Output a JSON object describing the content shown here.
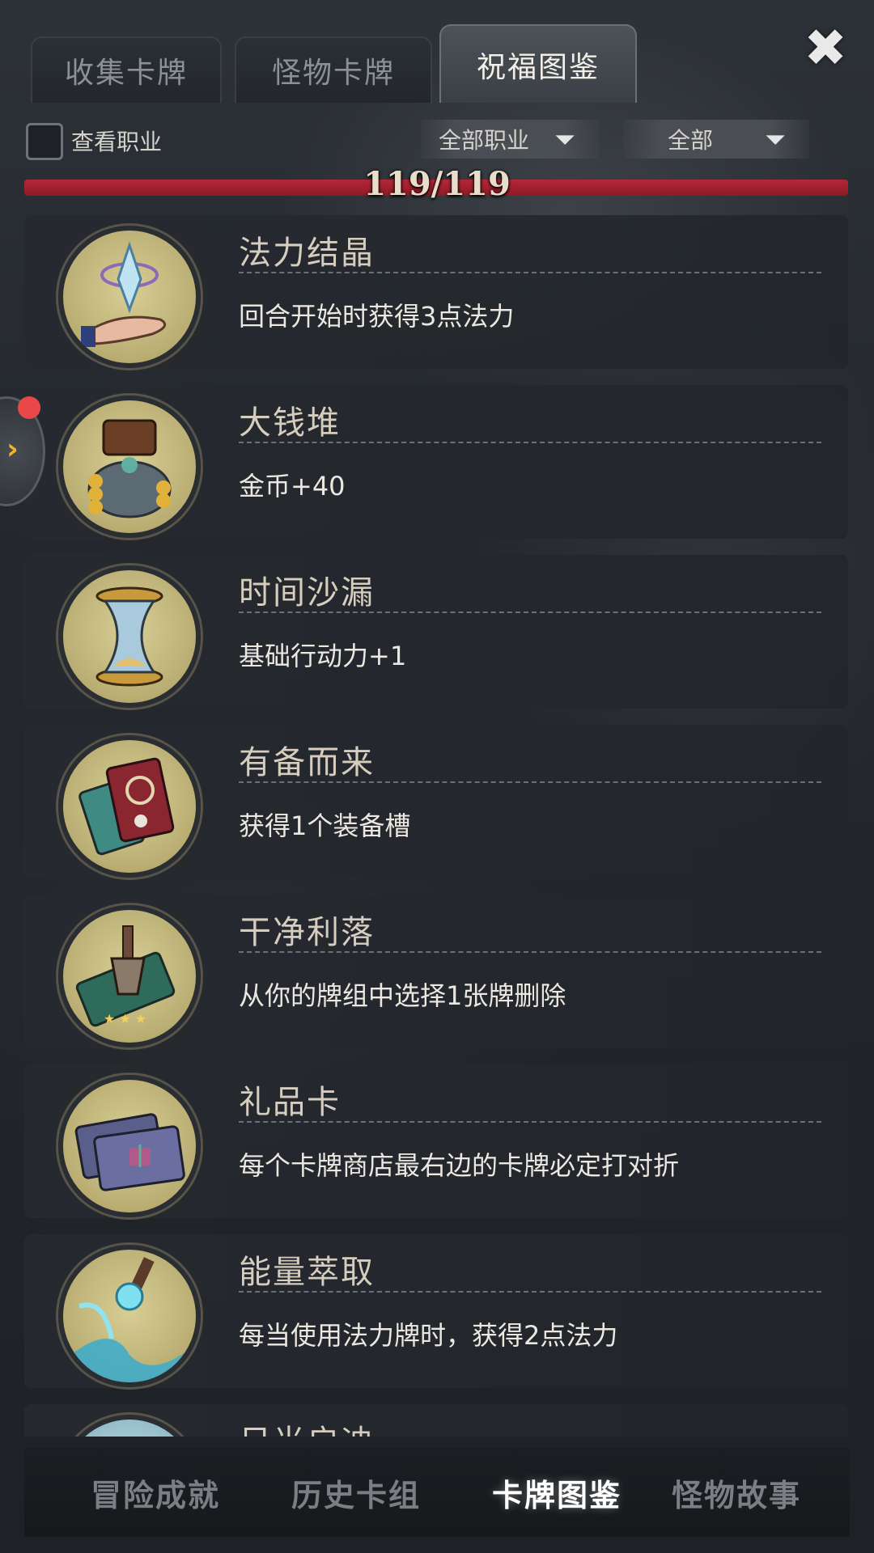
{
  "tabs": [
    {
      "label": "收集卡牌"
    },
    {
      "label": "怪物卡牌"
    },
    {
      "label": "祝福图鉴"
    }
  ],
  "close_icon": "close-icon",
  "filters": {
    "checkbox_label": "查看职业",
    "job_filter": "全部职业",
    "type_filter": "全部"
  },
  "progress": {
    "text": "119/119",
    "fraction": 1.0,
    "color": "#a52130"
  },
  "blessings": [
    {
      "name": "法力结晶",
      "desc": "回合开始时获得3点法力",
      "icon": "mana-crystal-icon"
    },
    {
      "name": "大钱堆",
      "desc": "金币+40",
      "icon": "treasure-pile-icon"
    },
    {
      "name": "时间沙漏",
      "desc": "基础行动力+1",
      "icon": "hourglass-icon"
    },
    {
      "name": "有备而来",
      "desc": "获得1个装备槽",
      "icon": "equipment-card-icon"
    },
    {
      "name": "干净利落",
      "desc": "从你的牌组中选择1张牌删除",
      "icon": "dagger-card-icon"
    },
    {
      "name": "礼品卡",
      "desc": "每个卡牌商店最右边的卡牌必定打对折",
      "icon": "gift-card-icon"
    },
    {
      "name": "能量萃取",
      "desc": "每当使用法力牌时，获得2点法力",
      "icon": "energy-orb-icon"
    },
    {
      "name": "日光启迪",
      "desc": "",
      "icon": "sunlight-icon"
    }
  ],
  "bottom_nav": [
    {
      "label": "冒险成就"
    },
    {
      "label": "历史卡组"
    },
    {
      "label": "卡牌图鉴"
    },
    {
      "label": "怪物故事"
    }
  ]
}
